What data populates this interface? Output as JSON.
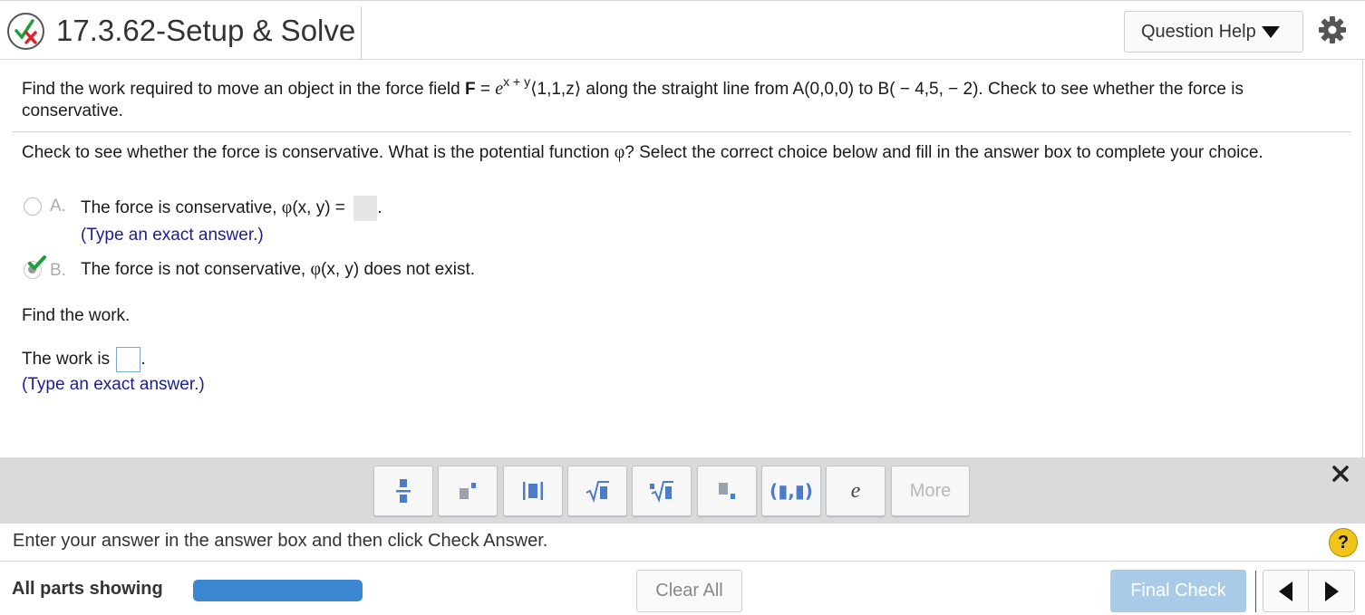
{
  "header": {
    "title": "17.3.62-Setup & Solve",
    "question_help": "Question Help"
  },
  "problem": {
    "text_before": "Find the work required to move an object in the force field ",
    "field_symbol": "F",
    "equals": " = ",
    "e": "e",
    "exponent": "x + y",
    "vector": "⟨1,1,z⟩",
    "text_after": " along the straight line from A(0,0,0) to B( − 4,5, − 2). Check to see whether the force is conservative."
  },
  "instruction": {
    "text_before": "Check to see whether the force is conservative. What is the potential function ",
    "phi": "φ",
    "text_after": "? Select the correct choice below and fill in the answer box to complete your choice."
  },
  "choices": [
    {
      "letter": "A.",
      "text_before": "The force is conservative, ",
      "phi": "φ",
      "text_after": "(x, y) = ",
      "end": ".",
      "hint": "(Type an exact answer.)",
      "selected": false
    },
    {
      "letter": "B.",
      "text_before": "The force is not conservative, ",
      "phi": "φ",
      "text_after": "(x, y) does not exist.",
      "selected": true
    }
  ],
  "work": {
    "prompt": "Find the work.",
    "label": "The work is ",
    "end": ".",
    "hint": "(Type an exact answer.)"
  },
  "toolbar": {
    "buttons": [
      {
        "name": "fraction-button",
        "glyph": "fraction-icon"
      },
      {
        "name": "exponent-button",
        "glyph": "exponent-icon"
      },
      {
        "name": "absolute-value-button",
        "glyph": "abs-icon"
      },
      {
        "name": "square-root-button",
        "glyph": "sqrt-icon"
      },
      {
        "name": "nth-root-button",
        "glyph": "nth-root-icon"
      },
      {
        "name": "subscript-button",
        "glyph": "subscript-icon"
      },
      {
        "name": "ordered-pair-button",
        "glyph": "(▮,▮)"
      },
      {
        "name": "euler-e-button",
        "glyph": "e"
      }
    ],
    "more_label": "More"
  },
  "footer": {
    "enter_answer": "Enter your answer in the answer box and then click Check Answer.",
    "help_symbol": "?",
    "parts_label": "All parts showing",
    "progress_fraction": 1.0,
    "clear_all": "Clear All",
    "final_check": "Final Check"
  },
  "colors": {
    "accent_blue": "#3b87d0",
    "final_check_bg": "#a9cbe8",
    "hint_text": "#1b1f8c",
    "toolbar_bg": "#d8dadc",
    "check_green": "#1e9e3a",
    "cross_red": "#d9232e"
  }
}
